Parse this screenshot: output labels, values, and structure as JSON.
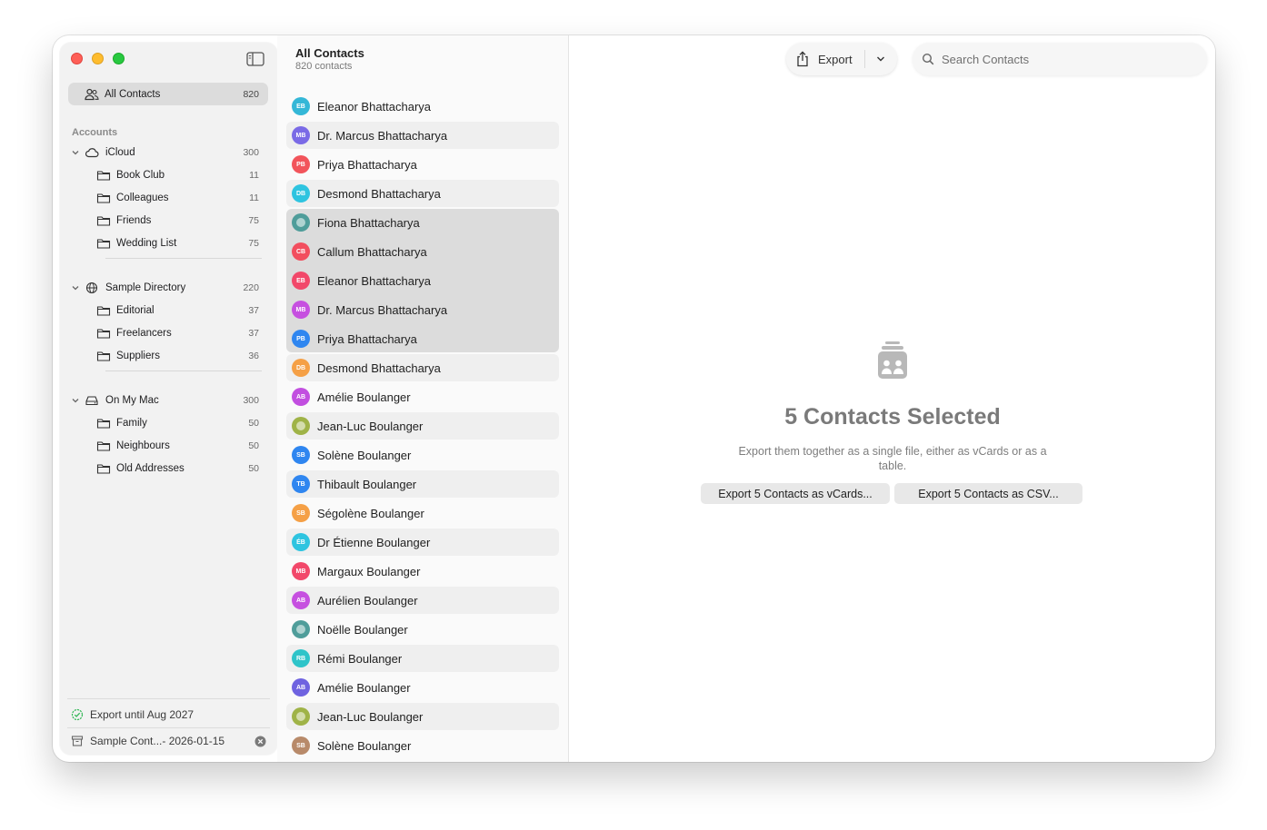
{
  "sidebar": {
    "all_contacts": {
      "label": "All Contacts",
      "count": "820"
    },
    "accounts_heading": "Accounts",
    "groups": [
      {
        "label": "iCloud",
        "count": "300",
        "icon": "cloud-icon",
        "children": [
          {
            "label": "Book Club",
            "count": "11"
          },
          {
            "label": "Colleagues",
            "count": "11"
          },
          {
            "label": "Friends",
            "count": "75"
          },
          {
            "label": "Wedding List",
            "count": "75"
          }
        ]
      },
      {
        "label": "Sample Directory",
        "count": "220",
        "icon": "globe-icon",
        "children": [
          {
            "label": "Editorial",
            "count": "37"
          },
          {
            "label": "Freelancers",
            "count": "37"
          },
          {
            "label": "Suppliers",
            "count": "36"
          }
        ]
      },
      {
        "label": "On My Mac",
        "count": "300",
        "icon": "drive-icon",
        "children": [
          {
            "label": "Family",
            "count": "50"
          },
          {
            "label": "Neighbours",
            "count": "50"
          },
          {
            "label": "Old Addresses",
            "count": "50"
          }
        ]
      }
    ],
    "footer": {
      "export_status": "Export until Aug 2027",
      "archive_label": "Sample Cont...- 2026-01-15"
    }
  },
  "list": {
    "title": "All Contacts",
    "subtitle": "820 contacts",
    "contacts": [
      {
        "name": "Eleanor Bhattacharya",
        "initials": "EB",
        "color": "#34b7d7"
      },
      {
        "name": "Dr. Marcus Bhattacharya",
        "initials": "MB",
        "color": "#7a6ae6"
      },
      {
        "name": "Priya Bhattacharya",
        "initials": "PB",
        "color": "#f2545b"
      },
      {
        "name": "Desmond Bhattacharya",
        "initials": "DB",
        "color": "#2ec4e0"
      },
      {
        "name": "Fiona Bhattacharya",
        "initials": "",
        "color": "#4f9d9a",
        "photo": true
      },
      {
        "name": "Callum Bhattacharya",
        "initials": "CB",
        "color": "#f24e5e"
      },
      {
        "name": "Eleanor Bhattacharya",
        "initials": "EB",
        "color": "#f2486a"
      },
      {
        "name": "Dr. Marcus Bhattacharya",
        "initials": "MB",
        "color": "#c650e0"
      },
      {
        "name": "Priya Bhattacharya",
        "initials": "PB",
        "color": "#2f86f0"
      },
      {
        "name": "Desmond Bhattacharya",
        "initials": "DB",
        "color": "#f5a046"
      },
      {
        "name": "Amélie Boulanger",
        "initials": "AB",
        "color": "#c24fe0"
      },
      {
        "name": "Jean-Luc Boulanger",
        "initials": "",
        "color": "#9fb347",
        "photo": true
      },
      {
        "name": "Solène Boulanger",
        "initials": "SB",
        "color": "#2f86f0"
      },
      {
        "name": "Thibault Boulanger",
        "initials": "TB",
        "color": "#2f86f0"
      },
      {
        "name": "Ségolène Boulanger",
        "initials": "SB",
        "color": "#f5a046"
      },
      {
        "name": "Dr Étienne Boulanger",
        "initials": "ÉB",
        "color": "#2ec4e0"
      },
      {
        "name": "Margaux Boulanger",
        "initials": "MB",
        "color": "#f2486a"
      },
      {
        "name": "Aurélien Boulanger",
        "initials": "AB",
        "color": "#c650e0"
      },
      {
        "name": "Noëlle Boulanger",
        "initials": "",
        "color": "#4f9d9a",
        "photo": true
      },
      {
        "name": "Rémi Boulanger",
        "initials": "RB",
        "color": "#2ec4c9"
      },
      {
        "name": "Amélie Boulanger",
        "initials": "AB",
        "color": "#6f63e0"
      },
      {
        "name": "Jean-Luc Boulanger",
        "initials": "",
        "color": "#9fb347",
        "photo": true
      },
      {
        "name": "Solène Boulanger",
        "initials": "SB",
        "color": "#b88a6a"
      }
    ]
  },
  "toolbar": {
    "export_label": "Export",
    "search_placeholder": "Search Contacts"
  },
  "detail": {
    "title": "5 Contacts Selected",
    "description": "Export them together as a single file, either as vCards or as a table.",
    "export_vcards": "Export 5 Contacts as vCards...",
    "export_csv": "Export 5 Contacts as CSV..."
  }
}
